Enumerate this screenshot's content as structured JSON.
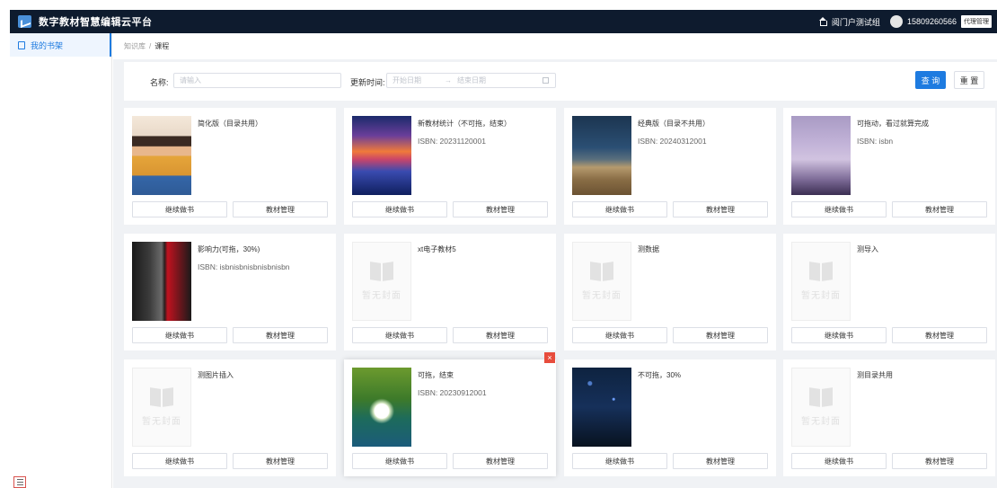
{
  "header": {
    "app_title": "数字教材智慧编辑云平台",
    "portal_label": "阅门户测试组",
    "phone": "15809260566",
    "role": "代理管理"
  },
  "sidebar": {
    "items": [
      {
        "label": "我的书架"
      }
    ]
  },
  "breadcrumb": {
    "parent": "知识库",
    "separator": "/",
    "current": "课程"
  },
  "filter": {
    "name_label": "名称:",
    "name_placeholder": "请输入",
    "time_label": "更新时间:",
    "start_placeholder": "开始日期",
    "range_sep": "→",
    "end_placeholder": "结束日期",
    "query_label": "查 询",
    "reset_label": "重 置"
  },
  "card_actions": {
    "continue": "继续做书",
    "manage": "教材管理"
  },
  "no_cover_text": "暂无封面",
  "books": [
    {
      "title": "简化版（目录共用）",
      "isbn": "",
      "cover": "girl"
    },
    {
      "title": "新教材统计（不可拖，结束）",
      "isbn": "ISBN: 20231120001",
      "cover": "sunset"
    },
    {
      "title": "经典版（目录不共用）",
      "isbn": "ISBN: 20240312001",
      "cover": "jeans"
    },
    {
      "title": "可拖动，看过就算完成",
      "isbn": "ISBN: isbn",
      "cover": "sky"
    },
    {
      "title": "影响力(可拖，30%)",
      "isbn": "ISBN: isbnisbnisbnisbnisbn",
      "cover": "mona"
    },
    {
      "title": "xt电子教材5",
      "isbn": "",
      "cover": "none"
    },
    {
      "title": "测数据",
      "isbn": "",
      "cover": "none"
    },
    {
      "title": "测导入",
      "isbn": "",
      "cover": "none"
    },
    {
      "title": "测图片插入",
      "isbn": "",
      "cover": "none"
    },
    {
      "title": "可拖，结束",
      "isbn": "ISBN: 20230912001",
      "cover": "flower"
    },
    {
      "title": "不可拖，30%",
      "isbn": "",
      "cover": "night"
    },
    {
      "title": "测目录共用",
      "isbn": "",
      "cover": "none"
    }
  ],
  "close_symbol": "×",
  "colors": {
    "topbar": "#0e1b2e",
    "accent": "#1e7be0",
    "background": "#f0f2f5",
    "close": "#e74c3c"
  }
}
